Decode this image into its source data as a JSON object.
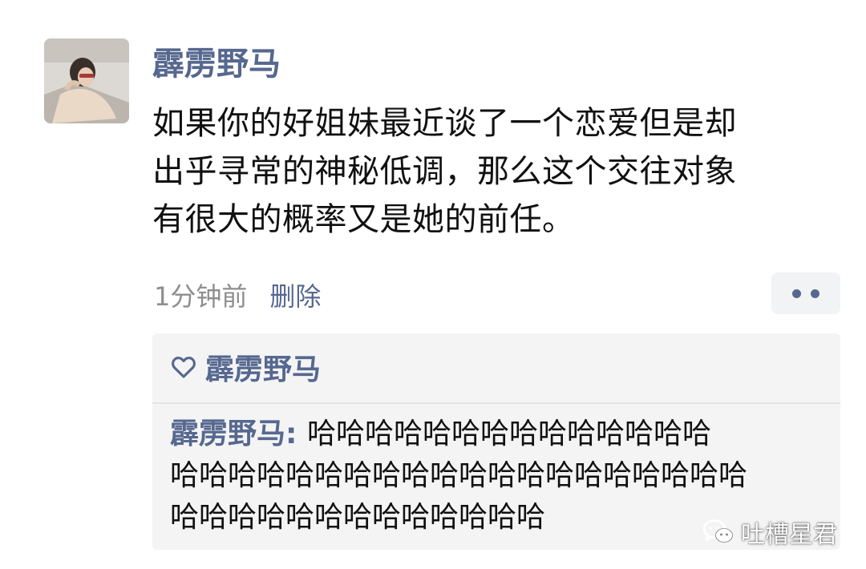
{
  "post": {
    "author": "霹雳野马",
    "text_lines": [
      "如果你的好姐妹最近谈了一个恋爱但是却",
      "出乎寻常的神秘低调，那么这个交往对象",
      "有很大的概率又是她的前任。"
    ],
    "time": "1分钟前",
    "delete_label": "删除"
  },
  "likes": {
    "icon": "heart-icon",
    "names": "霹雳野马"
  },
  "comment": {
    "author": "霹雳野马",
    "separator": ": ",
    "lines": [
      "哈哈哈哈哈哈哈哈哈哈哈哈哈哈",
      "哈哈哈哈哈哈哈哈哈哈哈哈哈哈哈哈哈哈哈哈",
      "哈哈哈哈哈哈哈哈哈哈哈哈哈"
    ]
  },
  "watermark": {
    "icon": "wechat-icon",
    "label": "吐槽星君"
  },
  "colors": {
    "link": "#56688f",
    "text": "#111111",
    "muted": "#8e8e8e",
    "panel": "#f4f4f5"
  }
}
